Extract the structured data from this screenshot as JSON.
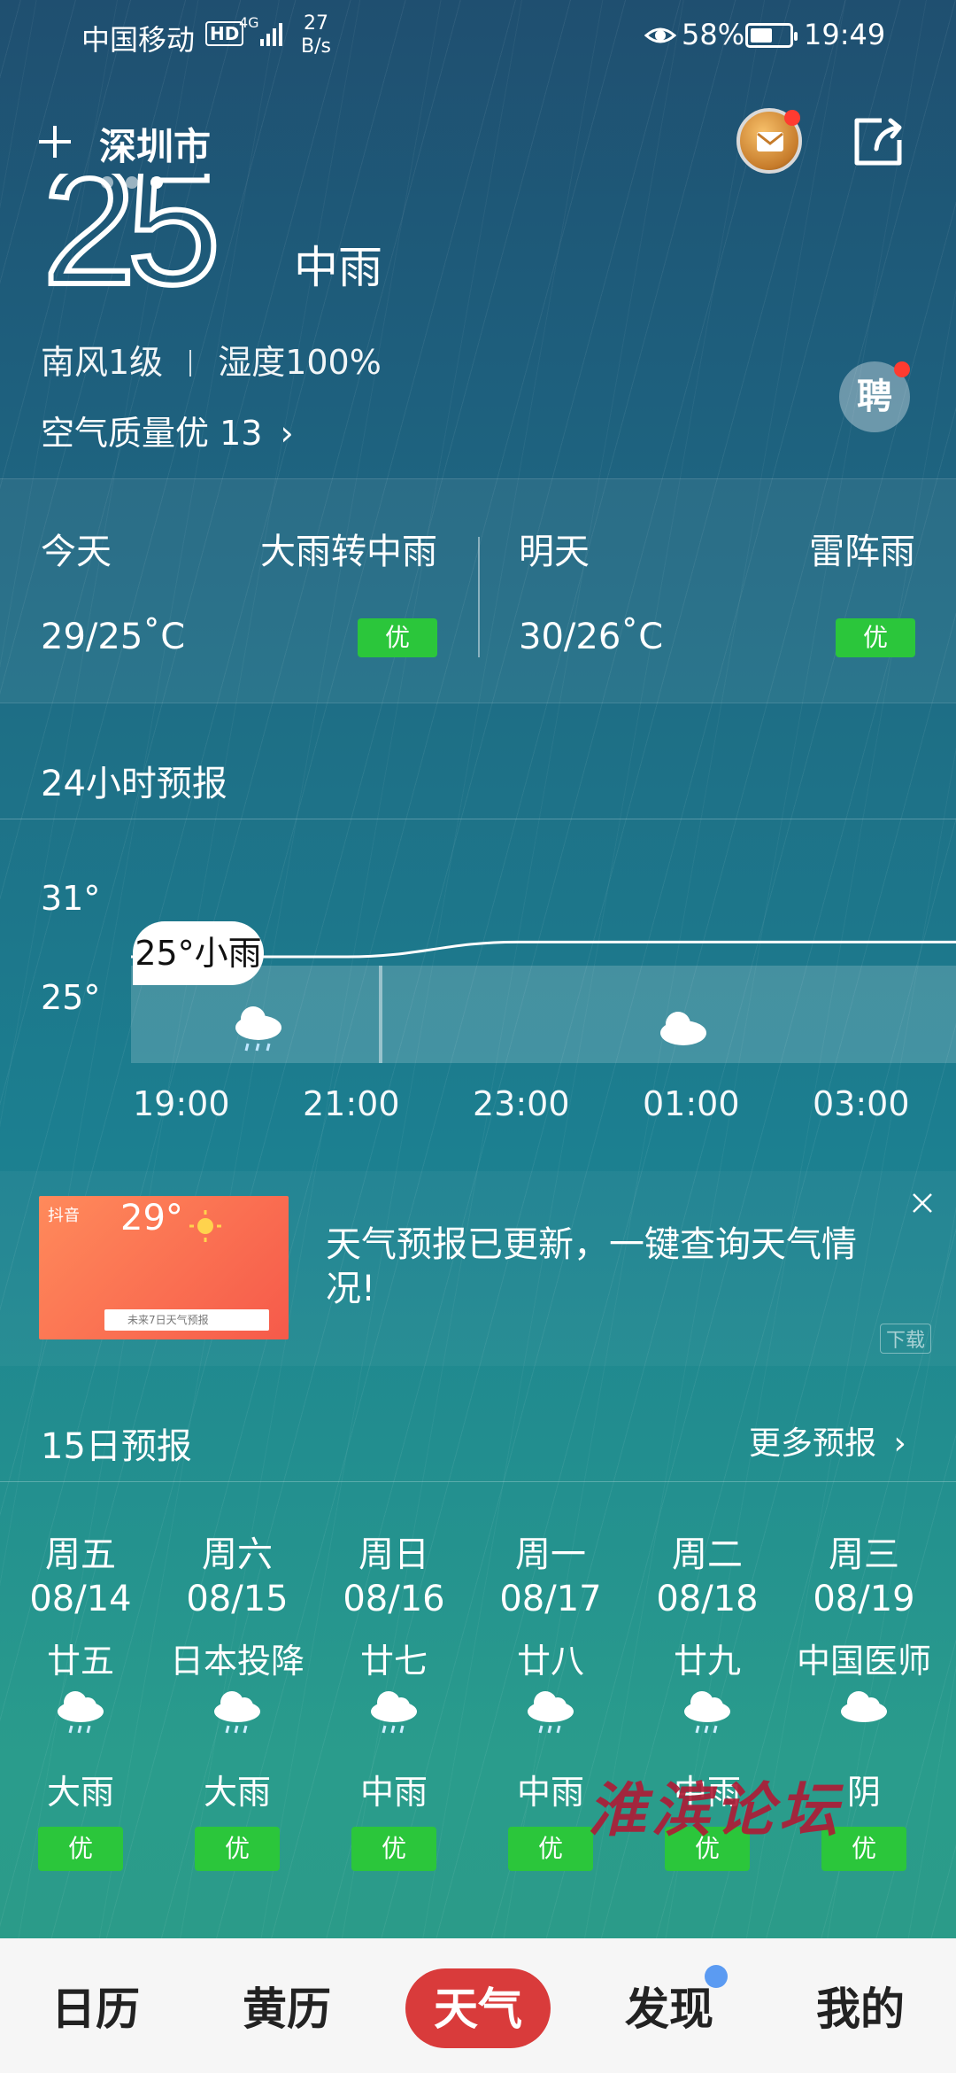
{
  "status_bar": {
    "carrier": "中国移动",
    "hd": "HD",
    "network": "4G",
    "speed_value": "27",
    "speed_unit": "B/s",
    "battery_percent": "58%",
    "battery_level": 0.58,
    "time": "19:49"
  },
  "header": {
    "city": "深圳市"
  },
  "current": {
    "temperature": "25",
    "condition": "中雨",
    "wind": "南风1级",
    "humidity": "湿度100%",
    "air_quality": "空气质量优 13",
    "recruit_label": "聘"
  },
  "today": {
    "label": "今天",
    "condition": "大雨转中雨",
    "temp_range": "29/25˚C",
    "aqi_badge": "优"
  },
  "tomorrow": {
    "label": "明天",
    "condition": "雷阵雨",
    "temp_range": "30/26˚C",
    "aqi_badge": "优"
  },
  "hourly": {
    "title": "24小时预报",
    "y_labels": [
      "31°",
      "25°"
    ],
    "callout": "25°小雨",
    "times": [
      "19:00",
      "21:00",
      "23:00",
      "01:00",
      "03:00"
    ]
  },
  "chart_data": {
    "type": "line",
    "x": [
      "19:00",
      "21:00",
      "23:00",
      "01:00",
      "03:00"
    ],
    "series": [
      {
        "values": [
          25,
          25,
          26,
          26,
          26
        ]
      }
    ],
    "ylim": [
      25,
      31
    ],
    "y_ticks": [
      "31°",
      "25°"
    ]
  },
  "ad": {
    "brand": "抖音",
    "image_temp": "29°",
    "image_search": "未来7日天气预报",
    "text": "天气预报已更新，一键查询天气情况!",
    "download": "下载"
  },
  "forecast": {
    "title": "15日预报",
    "more": "更多预报",
    "days": [
      {
        "weekday": "周五",
        "date": "08/14",
        "lunar": "廿五",
        "icon": "rain-cloud-icon",
        "condition": "大雨",
        "aqi": "优"
      },
      {
        "weekday": "周六",
        "date": "08/15",
        "lunar": "日本投降",
        "icon": "rain-cloud-icon",
        "condition": "大雨",
        "aqi": "优"
      },
      {
        "weekday": "周日",
        "date": "08/16",
        "lunar": "廿七",
        "icon": "rain-cloud-icon",
        "condition": "中雨",
        "aqi": "优"
      },
      {
        "weekday": "周一",
        "date": "08/17",
        "lunar": "廿八",
        "icon": "rain-cloud-icon",
        "condition": "中雨",
        "aqi": "优"
      },
      {
        "weekday": "周二",
        "date": "08/18",
        "lunar": "廿九",
        "icon": "rain-cloud-icon",
        "condition": "中雨",
        "aqi": "优"
      },
      {
        "weekday": "周三",
        "date": "08/19",
        "lunar": "中国医师",
        "icon": "cloud-icon",
        "condition": "阴",
        "aqi": "优"
      }
    ]
  },
  "watermark": "淮滨论坛",
  "bottom_nav": {
    "items": [
      "日历",
      "黄历",
      "天气",
      "发现",
      "我的"
    ],
    "active": "天气"
  },
  "colors": {
    "badge_green": "#2bc63b",
    "nav_active": "#d93b3b",
    "notify_red": "#ff3b30"
  }
}
